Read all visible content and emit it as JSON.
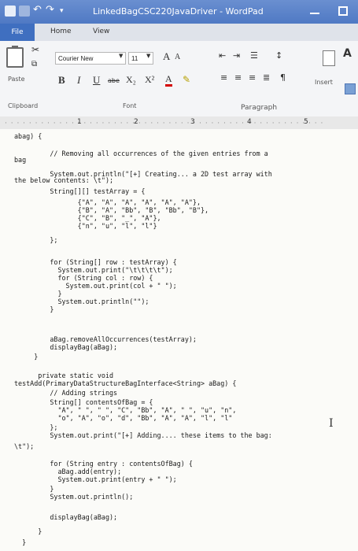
{
  "window": {
    "title": "LinkedBagCSC220JavaDriver - WordPad"
  },
  "menu": {
    "tabs": [
      "File",
      "Home",
      "View"
    ]
  },
  "ribbon": {
    "paste_label": "Paste",
    "clipboard_label": "Clipboard",
    "font_name": "Courier New",
    "font_size": "11",
    "font_label": "Font",
    "paragraph_label": "Paragraph",
    "insert_label": "Insert",
    "bold": "B",
    "italic": "I",
    "underline": "U",
    "strike": "abe",
    "subscript": "X₂",
    "superscript": "X²",
    "grow_font": "A",
    "shrink_font": "A",
    "font_color": "A"
  },
  "ruler": {
    "numbers": [
      "1",
      "2",
      "3",
      "4",
      "5"
    ]
  },
  "document": {
    "lines": [
      "abag) {",
      "         // Removing all occurrences of the given entries from a",
      "bag",
      "         System.out.println(\"[+] Creating... a 2D test array with",
      "the below contents: \\t\");",
      "         String[][] testArray = {",
      "                {\"A\", \"A\", \"A\", \"A\", \"A\", \"A\"},",
      "                {\"B\", \"A\", \"Bb\", \"B\", \"Bb\", \"B\"},",
      "                {\"C\", \"B\", \"_\", \"A\"},",
      "                {\"n\", \"u\", \"l\", \"l\"}",
      "         };",
      "",
      "         for (String[] row : testArray) {",
      "           System.out.print(\"\\t\\t\\t\\t\");",
      "           for (String col : row) {",
      "             System.out.print(col + \" \");",
      "           }",
      "           System.out.println(\"\");",
      "         }",
      "",
      "         aBag.removeAllOccurrences(testArray);",
      "         displayBag(aBag);",
      "     }",
      "",
      "      private static void",
      "testAdd(PrimaryDataStructureBagInterface<String> aBag) {",
      "         // Adding strings",
      "         String[] contentsOfBag = {",
      "           \"A\", \" \", \" \", \"C\", \"Bb\", \"A\", \" \", \"u\", \"n\",",
      "           \"o\", \"A\", \"o\", \"d\", \"Bb\", \"A\", \"A\", \"l\", \"l\"",
      "         };",
      "         System.out.print(\"[+] Adding.... these items to the bag:",
      "\\t\");",
      "         for (String entry : contentsOfBag) {",
      "           aBag.add(entry);",
      "           System.out.print(entry + \" \");",
      "         }",
      "         System.out.println();",
      "",
      "         displayBag(aBag);",
      "      }",
      "  }"
    ]
  },
  "colors": {
    "titlebar": "#5a83c9",
    "file_tab": "#3f6fc0",
    "ribbon_bg": "#f4f5f7",
    "doc_bg": "#fbfbf8"
  }
}
